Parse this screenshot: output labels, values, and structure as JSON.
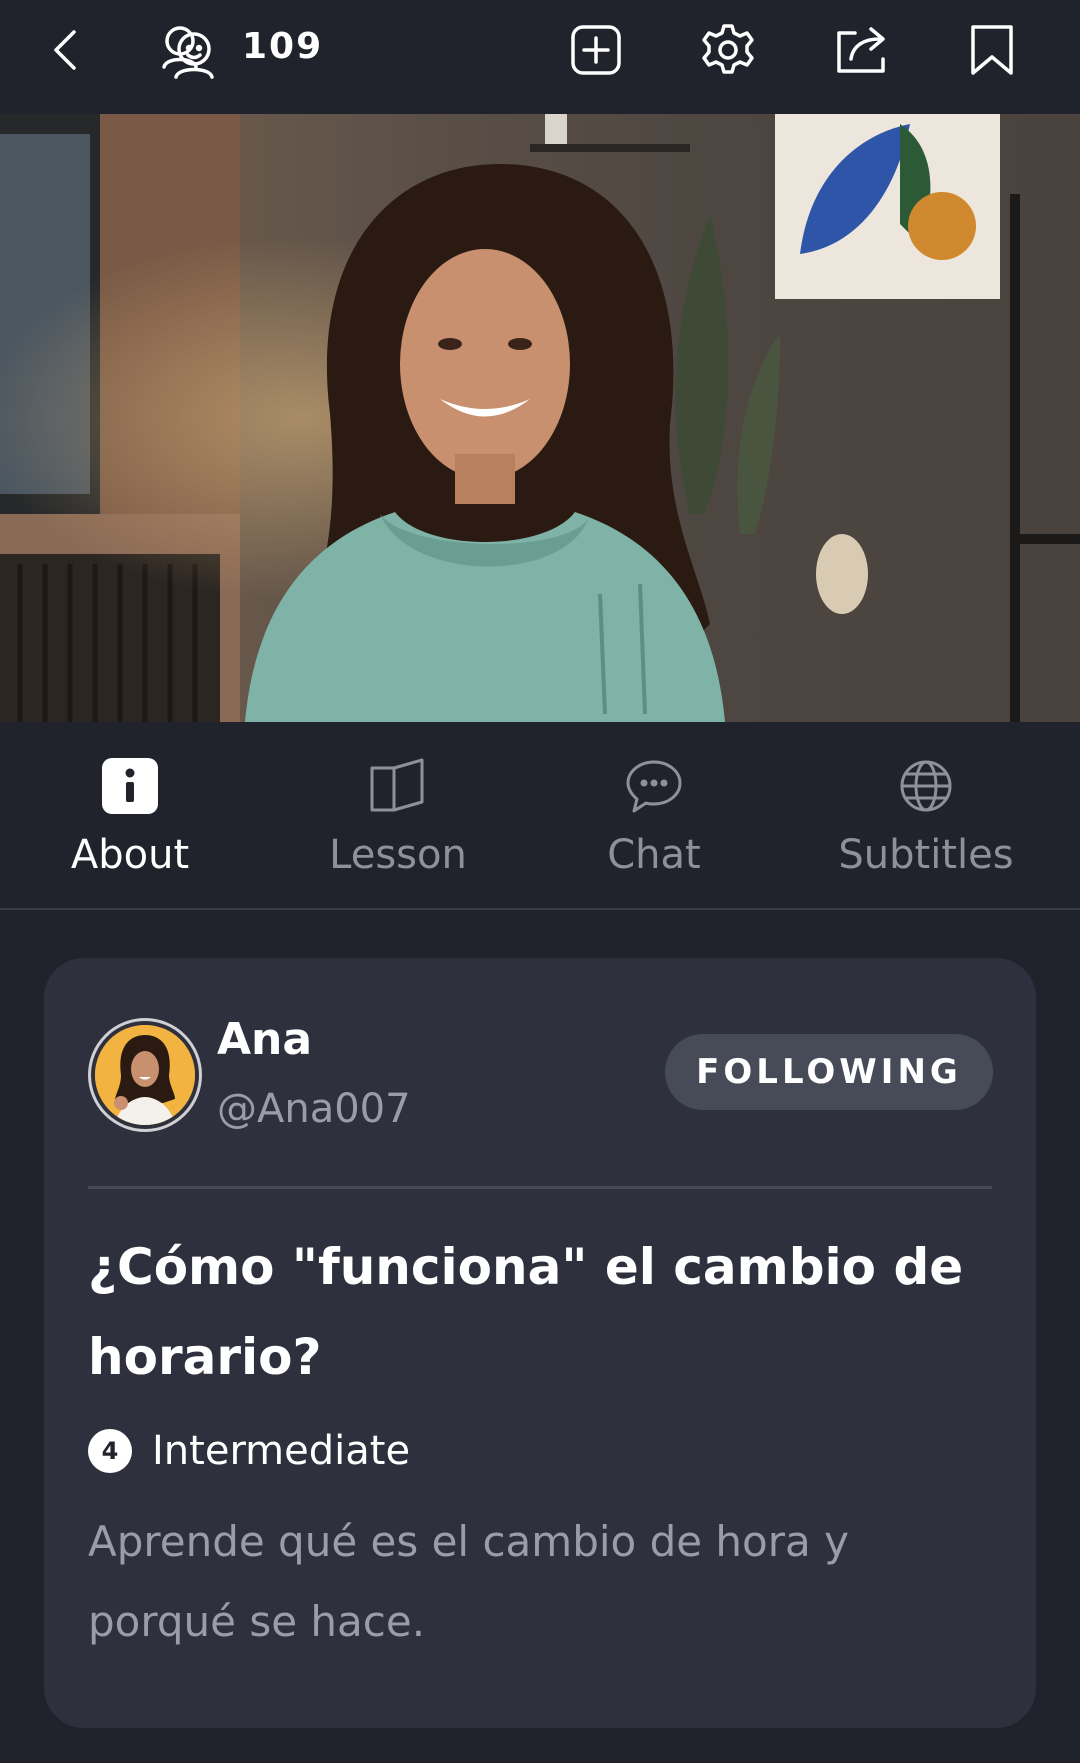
{
  "topbar": {
    "back_icon": "chevron-left-icon",
    "viewers_icon": "people-icon",
    "viewer_count": "109",
    "add_icon": "plus-square-icon",
    "settings_icon": "gear-icon",
    "share_icon": "share-icon",
    "bookmark_icon": "bookmark-icon"
  },
  "tabs": [
    {
      "label": "About",
      "icon": "info-icon",
      "active": true
    },
    {
      "label": "Lesson",
      "icon": "book-icon",
      "active": false
    },
    {
      "label": "Chat",
      "icon": "chat-bubble-icon",
      "active": false
    },
    {
      "label": "Subtitles",
      "icon": "globe-icon",
      "active": false
    }
  ],
  "author": {
    "name": "Ana",
    "handle": "@Ana007",
    "follow_label": "FOLLOWING"
  },
  "lesson": {
    "title": "¿Cómo \"funciona\" el cambio de horario?",
    "level_number": "4",
    "level_label": "Intermediate",
    "description": "Aprende qué es el cambio de hora y porqué se hace."
  },
  "colors": {
    "background": "#21232c",
    "card": "#2e313d",
    "button": "#474a57",
    "muted_text": "#9a9da8"
  }
}
